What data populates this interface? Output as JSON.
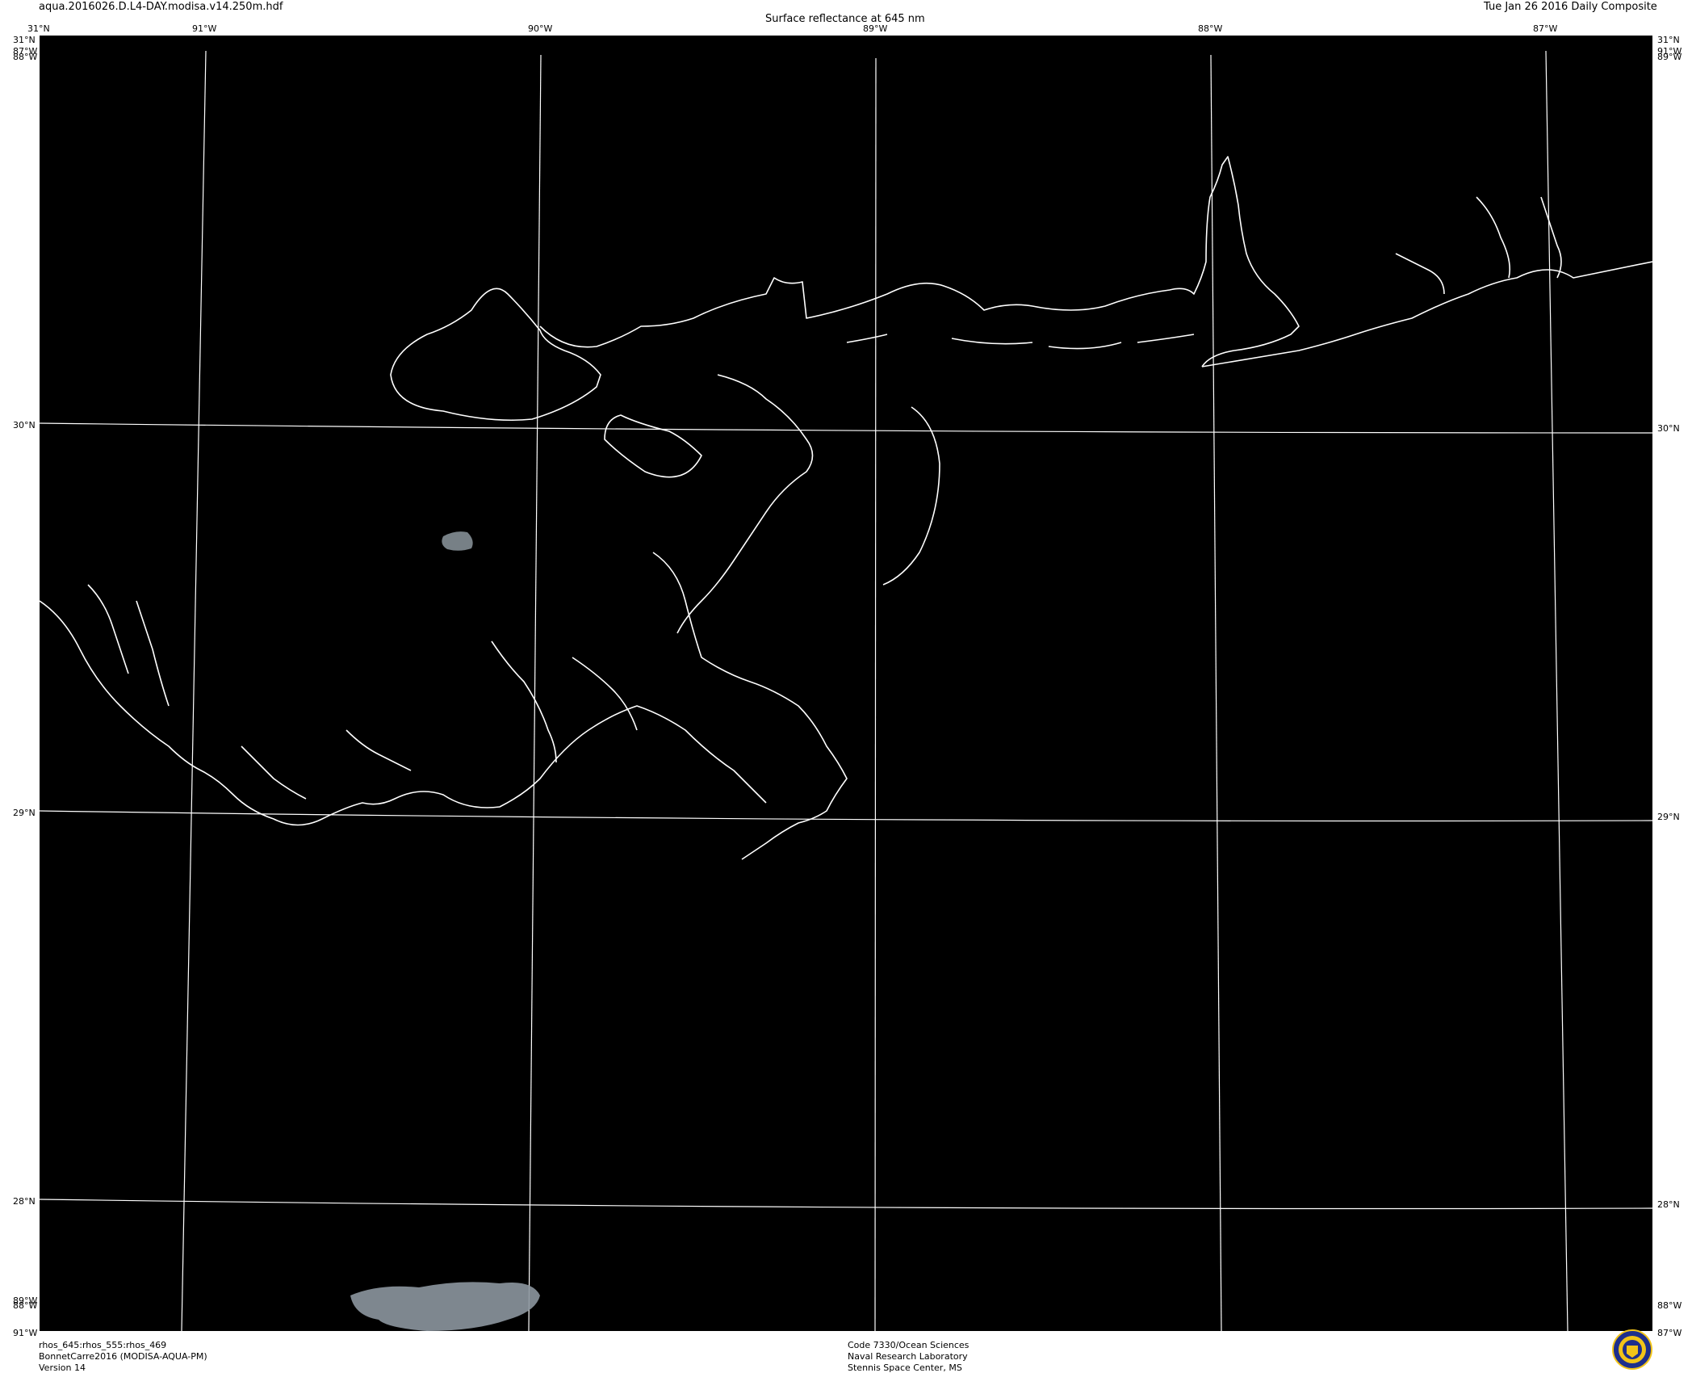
{
  "header": {
    "filename": "aqua.2016026.D.L4-DAY.modisa.v14.250m.hdf",
    "title": "Surface reflectance at 645 nm",
    "date": "Tue Jan 26 2016 Daily Composite"
  },
  "grid": {
    "lon_top": [
      "91°W",
      "90°W",
      "89°W",
      "88°W",
      "87°W"
    ],
    "lat_left": [
      "30°N",
      "29°N",
      "28°N"
    ],
    "lat_right": [
      "30°N",
      "29°N",
      "28°N"
    ],
    "corner_top_left": [
      "31°N",
      "87°W",
      "88°W"
    ],
    "corner_top_right": [
      "31°N",
      "91°W",
      "89°W"
    ],
    "corner_bottom_left": [
      "89°W",
      "88°W",
      "91°W"
    ],
    "corner_bottom_right": [
      "88°W",
      "87°W"
    ]
  },
  "footer": {
    "left": [
      "rhos_645:rhos_555:rhos_469",
      "BonnetCarre2016 (MODISA-AQUA-PM)",
      "Version 14"
    ],
    "center": [
      "Code 7330/Ocean Sciences",
      "Naval Research Laboratory",
      "Stennis Space Center, MS"
    ]
  },
  "colors": {
    "map_background": "#000000",
    "coastline": "#ffffff",
    "gridline": "#ffffff",
    "cloud": "#8c969e"
  },
  "logo": {
    "icon": "nrl-seal-icon",
    "ring_color": "#1e2f8c",
    "fill_color": "#f2c418"
  }
}
